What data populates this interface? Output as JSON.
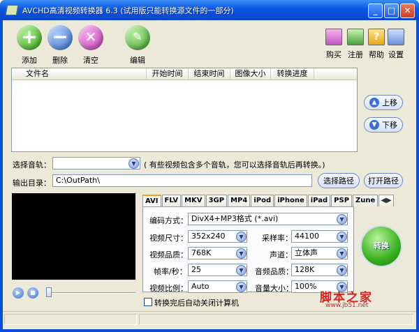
{
  "window": {
    "title": "AVCHD高清视频转换器 6.3 (试用版只能转换源文件的一部分)"
  },
  "toolbar": {
    "add": "添加",
    "delete": "删除",
    "clear": "清空",
    "edit": "编辑",
    "buy": "购买",
    "register": "注册",
    "help": "帮助",
    "settings": "设置"
  },
  "file_list": {
    "columns": [
      "文件名",
      "开始时间",
      "结束时间",
      "图像大小",
      "转换进度"
    ]
  },
  "side_buttons": {
    "move_up": "上移",
    "move_down": "下移"
  },
  "audio_track": {
    "label": "选择音轨：",
    "hint": "( 有些视频包含多个音轨，您可以选择音轨后再转换。)"
  },
  "output": {
    "label": "输出目录：",
    "path": "C:\\OutPath\\",
    "select_path": "选择路径",
    "open_path": "打开路径"
  },
  "tabs": [
    "AVI",
    "FLV",
    "MKV",
    "3GP",
    "MP4",
    "iPod",
    "iPhone",
    "iPad",
    "PSP",
    "Zune"
  ],
  "settings": {
    "encoding_label": "编码方式：",
    "encoding_value": "DivX4+MP3格式 (*.avi)",
    "video_size_label": "视频尺寸：",
    "video_size_value": "352x240",
    "sample_rate_label": "采样率：",
    "sample_rate_value": "44100",
    "video_quality_label": "视频品质：",
    "video_quality_value": "768K",
    "channel_label": "声道：",
    "channel_value": "立体声",
    "fps_label": "帧率/秒：",
    "fps_value": "25",
    "audio_quality_label": "音频品质：",
    "audio_quality_value": "128K",
    "aspect_label": "视频比例：",
    "aspect_value": "Auto",
    "volume_label": "音量大小：",
    "volume_value": "100%"
  },
  "convert": {
    "label": "转换"
  },
  "shutdown_checkbox": "转换完后自动关闭计算机",
  "watermark": {
    "brand": "脚本之家",
    "url": "www.jb51.net"
  },
  "colors": {
    "accent": "#0a4fd6",
    "convert_green": "#39b01e"
  }
}
